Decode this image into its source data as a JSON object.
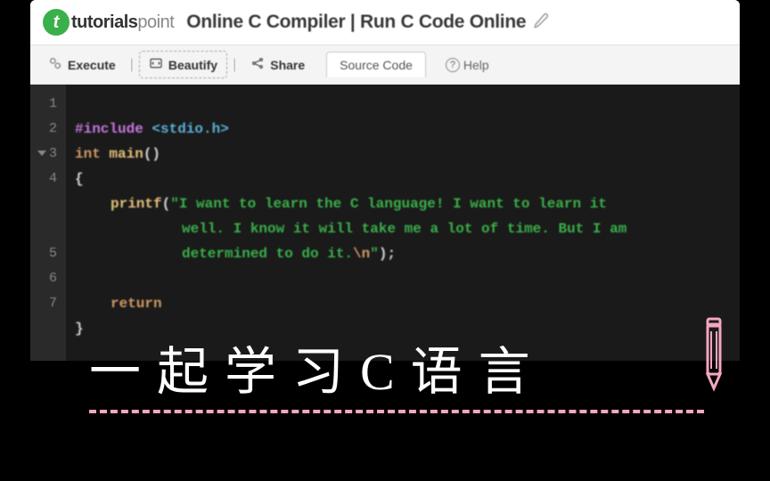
{
  "brand": {
    "logo_letter": "t",
    "name_bold": "tutorials",
    "name_light": "point"
  },
  "page_title": "Online C Compiler | Run C Code Online",
  "toolbar": {
    "execute": "Execute",
    "beautify": "Beautify",
    "share": "Share"
  },
  "tab": {
    "source_code": "Source Code"
  },
  "help": "Help",
  "code": {
    "lines": [
      "1",
      "2",
      "3",
      "4",
      "5",
      "6",
      "7"
    ],
    "l1_preproc": "#include ",
    "l1_header": "<stdio.h>",
    "l2_type": "int ",
    "l2_main": "main",
    "l2_paren": "()",
    "l3_brace": "{",
    "l4_call": "printf",
    "l4_open": "(",
    "l4_str1": "\"I want to learn the C language! I want to learn it",
    "l4_str2": "well. I know it will take me a lot of time. But I am",
    "l4_str3": "determined to do it.",
    "l4_esc": "\\n",
    "l4_str4": "\"",
    "l4_close": ");",
    "l6_return": "return",
    "l7_brace": "}"
  },
  "overlay_text": "一起学习C语言"
}
